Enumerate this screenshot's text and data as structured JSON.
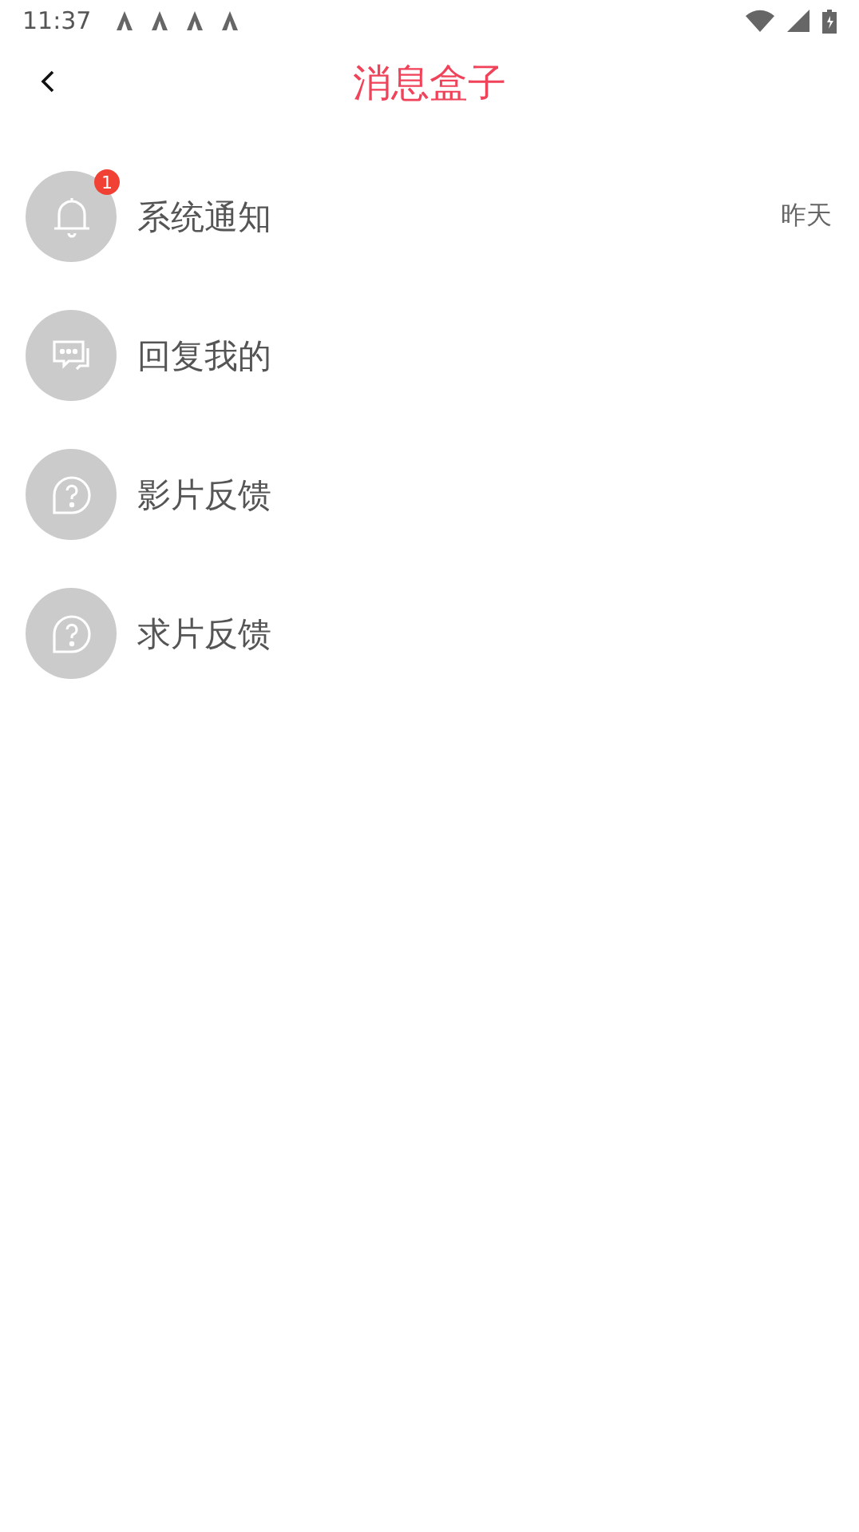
{
  "status_bar": {
    "time": "11:37"
  },
  "header": {
    "title": "消息盒子"
  },
  "items": [
    {
      "kind": "bell",
      "label": "系统通知",
      "badge": "1",
      "time": "昨天"
    },
    {
      "kind": "chat",
      "label": "回复我的"
    },
    {
      "kind": "question",
      "label": "影片反馈"
    },
    {
      "kind": "question",
      "label": "求片反馈"
    }
  ]
}
